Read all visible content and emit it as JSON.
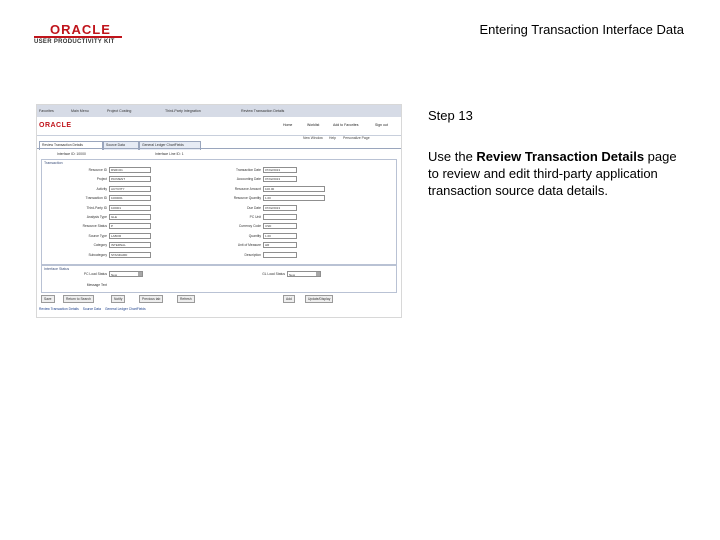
{
  "header": {
    "logo_text": "ORACLE",
    "logo_sub": "USER PRODUCTIVITY KIT",
    "title": "Entering Transaction Interface Data"
  },
  "step": {
    "label": "Step 13"
  },
  "description": {
    "prefix": "Use the ",
    "bold": "Review Transaction Details",
    "suffix": " page to review and edit third-party application transaction source data details."
  },
  "screenshot": {
    "brand": "ORACLE",
    "nav_items": [
      "Favorites",
      "Main Menu",
      "Project Costing",
      "Third-Party Integration",
      "Review Transaction Details"
    ],
    "header_links": [
      "Home",
      "Worklist",
      "Add to Favorites",
      "Sign out"
    ],
    "tool_links": [
      "New Window",
      "Help",
      "Personalize Page"
    ],
    "tabs": [
      "Review Transaction Details",
      "Source Data",
      "General Ledger ChartFields"
    ],
    "top_fields": [
      "Interface ID: 10000",
      "Interface Line ID: 1"
    ],
    "transaction_box": {
      "title": "Transaction",
      "left_labels": [
        "Resource ID",
        "Project",
        "Activity",
        "Transaction ID",
        "Third-Party ID",
        "Analysis Type",
        "Resource Status",
        "Source Type",
        "Category",
        "Subcategory"
      ],
      "left_values": [
        "RSRC01",
        "PAYMENT",
        "ACTIVITY",
        "1000001",
        "100001",
        "GLE",
        "P",
        "LABOR",
        "INTERNAL",
        "STANDARD"
      ],
      "right_labels": [
        "Transaction Date",
        "Accounting Date",
        "Resource Amount",
        "Resource Quantity",
        "Due Date",
        "PC Unit",
        "Currency Code",
        "Quantity",
        "Unit of Measure",
        "Description"
      ],
      "right_values": [
        "07/02/2013",
        "07/02/2013",
        "100.00",
        "1.00",
        "07/02/2013",
        "",
        "USD",
        "1.00",
        "HR",
        ""
      ]
    },
    "status_box": {
      "title": "Interface Status",
      "left_label": "PC Load Status",
      "left_value": "New",
      "right_label": "GL Load Status",
      "right_value": "New",
      "message_label": "Message Text"
    },
    "buttons": [
      "Save",
      "Return to Search",
      "Notify",
      "Previous tab",
      "Refresh",
      "Add",
      "Update/Display"
    ],
    "bottom_links": [
      "Review Transaction Details",
      "Source Data",
      "General Ledger ChartFields"
    ]
  }
}
